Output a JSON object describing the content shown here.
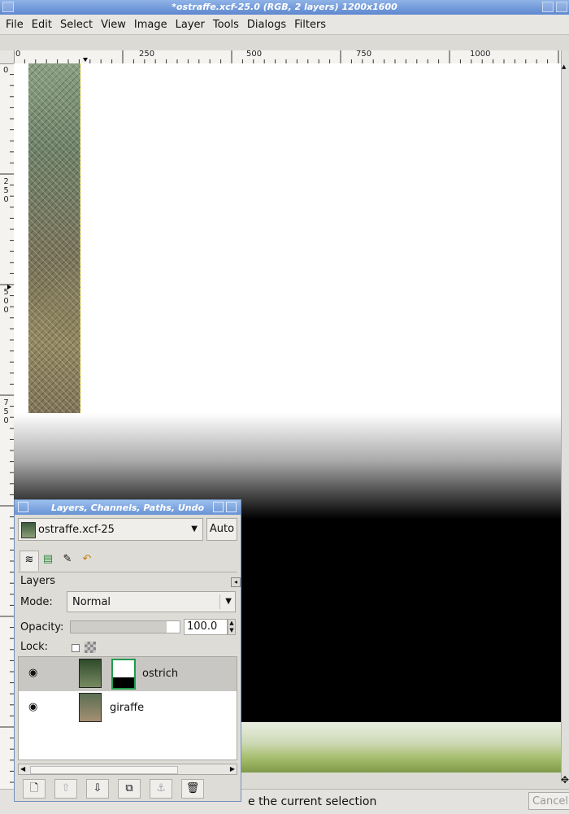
{
  "window": {
    "title": "*ostraffe.xcf-25.0 (RGB, 2 layers) 1200x1600"
  },
  "menu": [
    "File",
    "Edit",
    "Select",
    "View",
    "Image",
    "Layer",
    "Tools",
    "Dialogs",
    "Filters"
  ],
  "ruler": {
    "h_labels": [
      "0",
      "250",
      "500",
      "750",
      "1000"
    ],
    "v_labels": [
      "0",
      "250",
      "500",
      "750"
    ]
  },
  "statusbar": {
    "text": "e the current selection",
    "cancel_label": "Cancel"
  },
  "dock": {
    "title": "Layers, Channels, Paths, Undo",
    "image_menu": "ostraffe.xcf-25",
    "auto_label": "Auto",
    "tab_icons": [
      "layers-tab-icon",
      "channels-tab-icon",
      "paths-tab-icon",
      "undo-tab-icon"
    ],
    "header_label": "Layers",
    "mode_label": "Mode:",
    "mode_value": "Normal",
    "opacity_label": "Opacity:",
    "opacity_value": "100.0",
    "opacity_fraction": 1.0,
    "lock_label": "Lock:",
    "layers": [
      {
        "name": "ostrich",
        "visible": true,
        "has_mask": true,
        "selected": true
      },
      {
        "name": "giraffe",
        "visible": true,
        "has_mask": false,
        "selected": false
      }
    ]
  }
}
